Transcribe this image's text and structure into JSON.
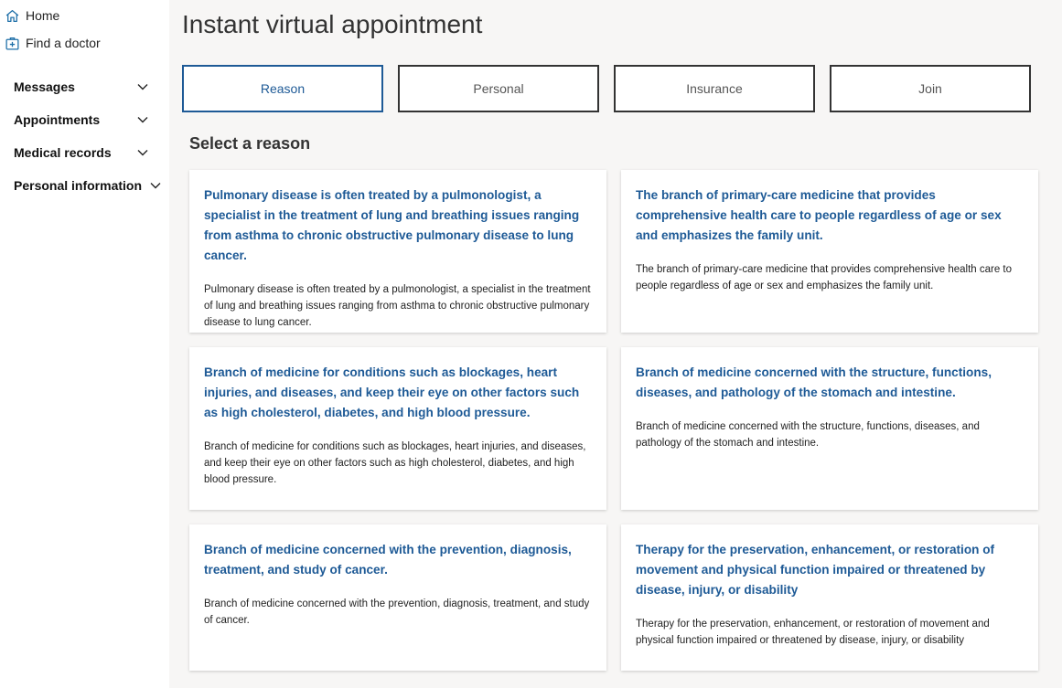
{
  "sidebar": {
    "links": [
      {
        "label": "Home",
        "icon": "home-icon"
      },
      {
        "label": "Find a doctor",
        "icon": "doctor-icon"
      }
    ],
    "sections": [
      {
        "label": "Messages"
      },
      {
        "label": "Appointments"
      },
      {
        "label": "Medical records"
      },
      {
        "label": "Personal information"
      }
    ]
  },
  "page": {
    "title": "Instant virtual appointment",
    "section_title": "Select a reason"
  },
  "steps": [
    {
      "label": "Reason",
      "active": true
    },
    {
      "label": "Personal",
      "active": false
    },
    {
      "label": "Insurance",
      "active": false
    },
    {
      "label": "Join",
      "active": false
    }
  ],
  "reasons": [
    {
      "title": "Pulmonary disease is often treated by a pulmonologist, a specialist in the treatment of lung and breathing issues ranging from asthma to chronic obstructive pulmonary disease to lung cancer.",
      "description": "Pulmonary disease is often treated by a pulmonologist, a specialist in the treatment of lung and breathing issues ranging from asthma to chronic obstructive pulmonary disease to lung cancer."
    },
    {
      "title": "The branch of primary-care medicine that provides comprehensive health care to people regardless of age or sex and emphasizes the family unit.",
      "description": "The branch of primary-care medicine that provides comprehensive health care to people regardless of age or sex and emphasizes the family unit."
    },
    {
      "title": "Branch of medicine for conditions such as blockages, heart injuries, and diseases, and keep their eye on other factors such as high cholesterol, diabetes, and high blood pressure.",
      "description": "Branch of medicine for conditions such as blockages, heart injuries, and diseases, and keep their eye on other factors such as high cholesterol, diabetes, and high blood pressure."
    },
    {
      "title": "Branch of medicine concerned with the structure, functions, diseases, and pathology of the stomach and intestine.",
      "description": "Branch of medicine concerned with the structure, functions, diseases, and pathology of the stomach and intestine."
    },
    {
      "title": "Branch of medicine concerned with the prevention, diagnosis, treatment, and study of cancer.",
      "description": "Branch of medicine concerned with the prevention, diagnosis, treatment, and study of cancer."
    },
    {
      "title": "Therapy for the preservation, enhancement, or restoration of movement and physical function impaired or threatened by disease, injury, or disability",
      "description": "Therapy for the preservation, enhancement, or restoration of movement and physical function impaired or threatened by disease, injury, or disability"
    }
  ],
  "colors": {
    "accent": "#1e5a96",
    "background": "#f7f6f5",
    "sidebar": "#ffffff"
  }
}
